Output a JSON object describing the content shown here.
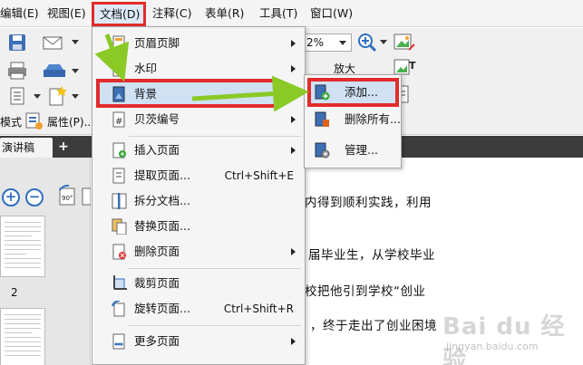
{
  "menubar": {
    "items": [
      {
        "label": "编辑(E)"
      },
      {
        "label": "视图(E)"
      },
      {
        "label": "文档(D)"
      },
      {
        "label": "注释(C)"
      },
      {
        "label": "表单(R)"
      },
      {
        "label": "工具(T)"
      },
      {
        "label": "窗口(W)"
      }
    ]
  },
  "toolbar": {
    "zoom_value": "2%",
    "enlarge_label": "放大",
    "mode_label": "模式",
    "properties_label": "属性(P)..."
  },
  "tabs": {
    "doc_tab_label": "演讲稿",
    "add_tab_label": "+"
  },
  "thumbnails": {
    "page_label": "2"
  },
  "document": {
    "lines": [
      "内得到顺利实践，利用",
      "届毕业生，从学校毕业",
      "校把他引到学校“创业",
      "，终于走出了创业困境"
    ]
  },
  "doc_menu": {
    "items": [
      {
        "label": "页眉页脚",
        "shortcut": ""
      },
      {
        "label": "水印",
        "shortcut": ""
      },
      {
        "label": "背景",
        "shortcut": ""
      },
      {
        "label": "贝茨编号",
        "shortcut": ""
      },
      {
        "label": "插入页面",
        "shortcut": ""
      },
      {
        "label": "提取页面...",
        "shortcut": "Ctrl+Shift+E"
      },
      {
        "label": "拆分文档...",
        "shortcut": ""
      },
      {
        "label": "替换页面...",
        "shortcut": ""
      },
      {
        "label": "删除页面",
        "shortcut": ""
      },
      {
        "label": "裁剪页面",
        "shortcut": ""
      },
      {
        "label": "旋转页面...",
        "shortcut": "Ctrl+Shift+R"
      },
      {
        "label": "更多页面",
        "shortcut": ""
      }
    ]
  },
  "background_submenu": {
    "items": [
      {
        "label": "添加..."
      },
      {
        "label": "删除所有..."
      },
      {
        "label": "管理..."
      }
    ]
  },
  "watermark": {
    "brand": "Bai du 经验",
    "url": "jingyan.baidu.com"
  },
  "colors": {
    "highlight_red": "#e22b2b",
    "arrow_green": "#8ac926",
    "selection_blue": "#cfe1f3"
  }
}
